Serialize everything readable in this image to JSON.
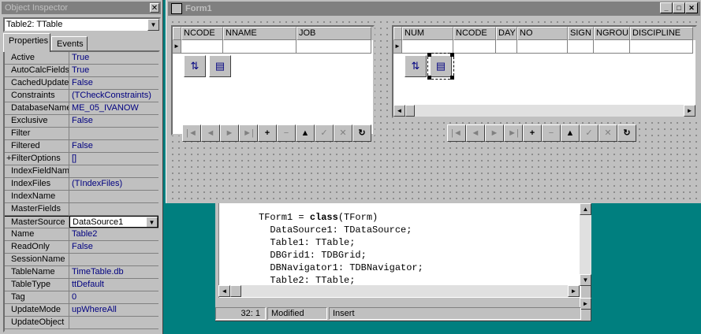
{
  "object_inspector": {
    "title": "Object Inspector",
    "object_selector": "Table2: TTable",
    "tabs": [
      "Properties",
      "Events"
    ],
    "properties": [
      {
        "name": "Active",
        "value": "True"
      },
      {
        "name": "AutoCalcFields",
        "value": "True"
      },
      {
        "name": "CachedUpdates",
        "value": "False"
      },
      {
        "name": "Constraints",
        "value": "(TCheckConstraints)"
      },
      {
        "name": "DatabaseName",
        "value": "ME_05_IVANOW"
      },
      {
        "name": "Exclusive",
        "value": "False"
      },
      {
        "name": "Filter",
        "value": ""
      },
      {
        "name": "Filtered",
        "value": "False"
      },
      {
        "name": "+FilterOptions",
        "value": "[]"
      },
      {
        "name": "IndexFieldName",
        "value": ""
      },
      {
        "name": "IndexFiles",
        "value": "(TIndexFiles)"
      },
      {
        "name": "IndexName",
        "value": ""
      },
      {
        "name": "MasterFields",
        "value": ""
      },
      {
        "name": "MasterSource",
        "value": "DataSource1"
      },
      {
        "name": "Name",
        "value": "Table2"
      },
      {
        "name": "ReadOnly",
        "value": "False"
      },
      {
        "name": "SessionName",
        "value": ""
      },
      {
        "name": "TableName",
        "value": "TimeTable.db"
      },
      {
        "name": "TableType",
        "value": "ttDefault"
      },
      {
        "name": "Tag",
        "value": "0"
      },
      {
        "name": "UpdateMode",
        "value": "upWhereAll"
      },
      {
        "name": "UpdateObject",
        "value": ""
      }
    ]
  },
  "form1": {
    "title": "Form1",
    "grid1": {
      "columns": [
        "NCODE",
        "NNAME",
        "JOB"
      ]
    },
    "grid2": {
      "columns": [
        "NUM",
        "NCODE",
        "DAY",
        "NO",
        "SIGN",
        "NGROUP",
        "DISCIPLINE"
      ]
    }
  },
  "editor": {
    "lines": [
      {
        "text": "TForm1 = class(TForm)"
      },
      {
        "text": "  DataSource1: TDataSource;"
      },
      {
        "text": "  Table1: TTable;"
      },
      {
        "text": "  DBGrid1: TDBGrid;"
      },
      {
        "text": "  DBNavigator1: TDBNavigator;"
      },
      {
        "text": "  Table2: TTable;"
      }
    ],
    "status": {
      "position": "32:  1",
      "modified": "Modified",
      "mode": "Insert"
    }
  },
  "colors": {
    "desktop": "#007f7f",
    "face": "#c0c0c0",
    "value_text": "#000080"
  }
}
